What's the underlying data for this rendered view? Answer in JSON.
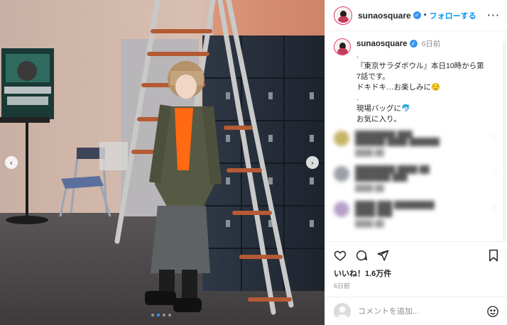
{
  "post": {
    "username": "sunaosquare",
    "follow_label": "フォローする",
    "separator": "•",
    "more_label": "···"
  },
  "caption": {
    "username": "sunaosquare",
    "time": "6日前",
    "lines": [
      ".",
      "『東京サラダボウル』本日10時から第",
      "7話です。",
      "ドキドキ…お楽しみに😌",
      ".",
      "現場バッグに🐬",
      "お気に入り。"
    ]
  },
  "comments": [
    {
      "text": "████████ ███",
      "reply": "██████ ████ ██████",
      "sub": "████ ██"
    },
    {
      "text": "████████ ████ ██",
      "reply": "███████ ███",
      "sub": "████ ██"
    },
    {
      "text": "████ ███ ████████",
      "reply": "████ ███",
      "sub": "████ ██"
    },
    {
      "text": "█████ ████████",
      "reply": "██████",
      "sub": "████ ██"
    }
  ],
  "engagement": {
    "likes": "いいね！1.6万件",
    "date": "6日前"
  },
  "comment_box": {
    "placeholder": "コメントを追加..."
  },
  "carousel": {
    "prev": "‹",
    "next": "›",
    "total": 4,
    "active": 2
  },
  "colors": {
    "accent": "#0095f6",
    "verified": "#3897f0",
    "story_ring": "#e1306c"
  },
  "icons": {
    "like": "heart-icon",
    "comment": "comment-icon",
    "share": "share-icon",
    "save": "bookmark-icon",
    "emoji": "smiley-icon"
  }
}
